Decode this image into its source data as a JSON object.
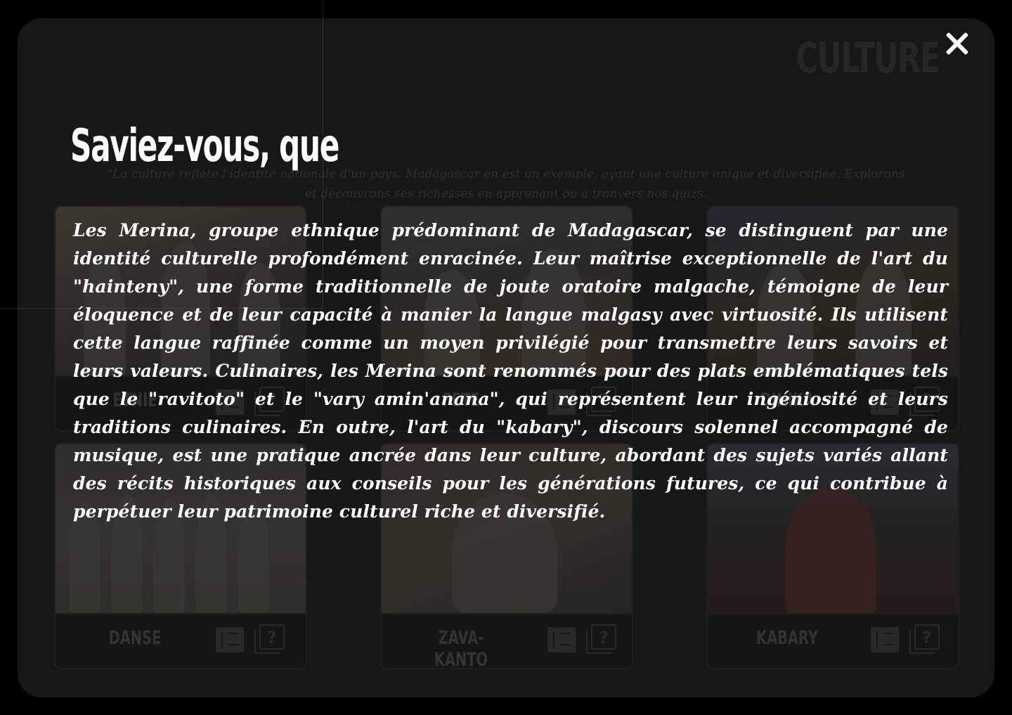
{
  "page": {
    "title": "CULTURE",
    "intro": "\"La culture reflète l'identité nationale d'un pays. Madagascar en est un exemple, ayant une culture unique et diversifiée. Explorons et découvrons ses richesses en apprenant ou a tranvers nos quizs."
  },
  "cards": [
    {
      "label": "ETNIE",
      "art": "ethnic-group-artwork"
    },
    {
      "label": "FETE",
      "art": "festival-artwork"
    },
    {
      "label": "DINIKA",
      "art": "discussion-artwork"
    },
    {
      "label": "DANSE",
      "art": "dancers-artwork"
    },
    {
      "label": "ZAVA-KANTO",
      "art": "portrait-artwork"
    },
    {
      "label": "KABARY",
      "art": "orator-artwork"
    }
  ],
  "icons": {
    "close": "close-icon",
    "learn": "book-icon",
    "quiz": "quiz-icon"
  },
  "modal": {
    "title": "Saviez-vous, que",
    "body": "Les Merina, groupe ethnique prédominant de Madagascar, se distinguent par une identité culturelle profondément enracinée. Leur maîtrise exceptionnelle de l'art du \"hainteny\", une forme traditionnelle de joute oratoire malgache, témoigne de leur éloquence et de leur capacité à manier la langue malgasy avec virtuosité. Ils utilisent cette langue raffinée comme un moyen privilégié pour transmettre leurs savoirs et leurs valeurs. Culinaires, les Merina sont renommés pour des plats emblématiques tels que le \"ravitoto\" et le \"vary amin'anana\", qui représentent leur ingéniosité et leurs traditions culinaires. En outre, l'art du \"kabary\", discours solennel accompagné de musique, est une pratique ancrée dans leur culture, abordant des sujets variés allant des récits historiques aux conseils pour les générations futures, ce qui contribue à perpétuer leur patrimoine culturel riche et diversifié."
  },
  "colors": {
    "backdrop": "#000000",
    "panel": "#2a2a2a",
    "modal_text": "#ffffff",
    "muted_text": "#5c5c5c"
  }
}
